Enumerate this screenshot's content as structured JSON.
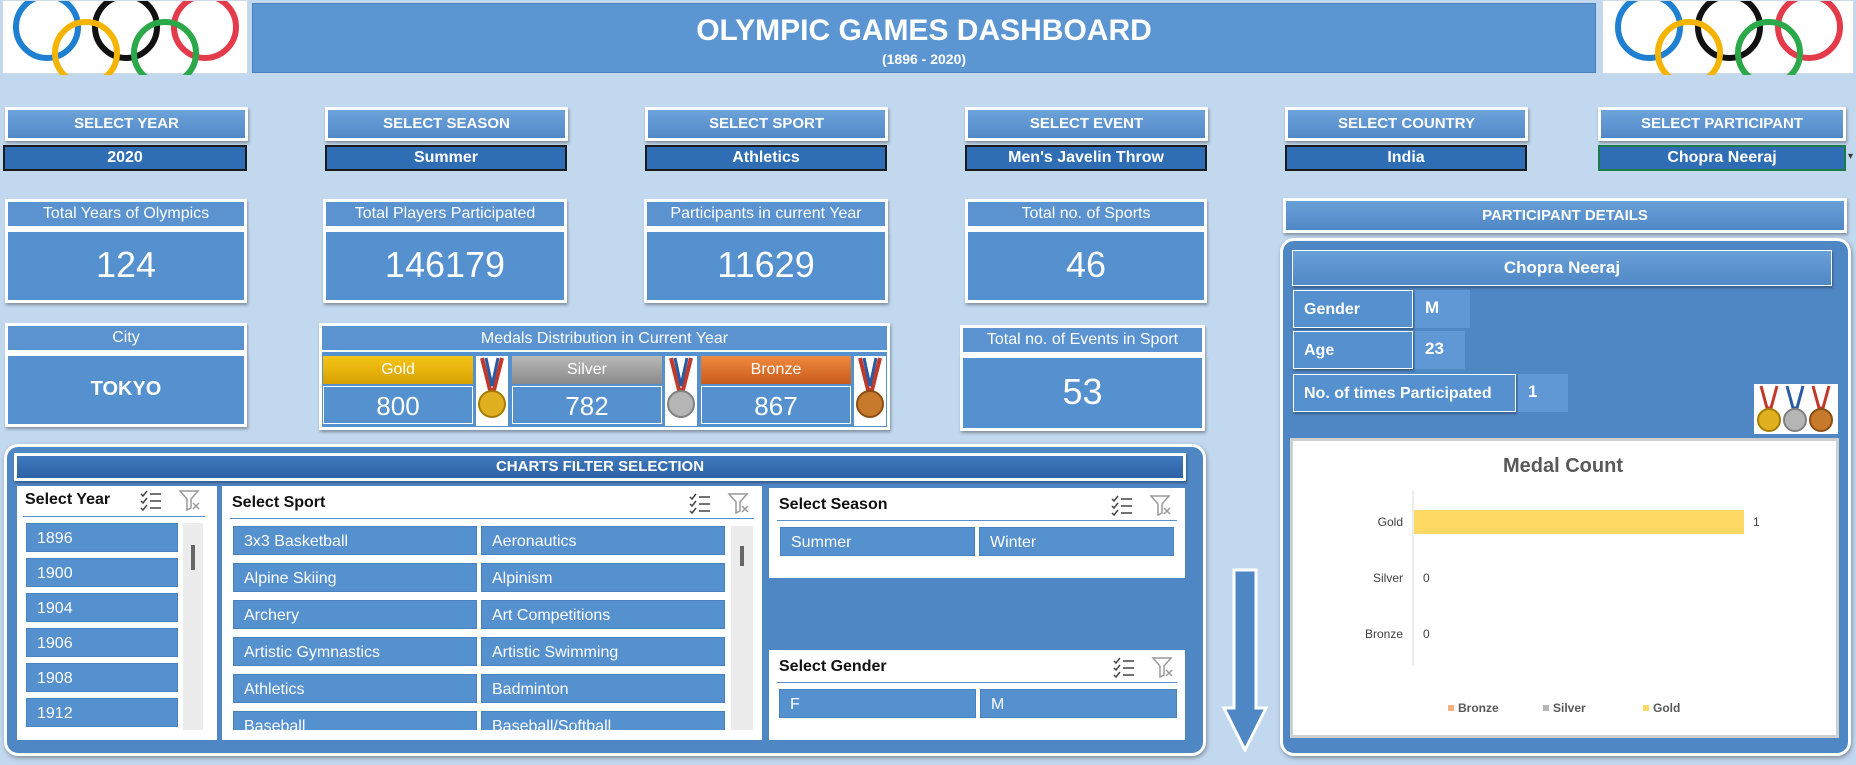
{
  "header": {
    "title": "OLYMPIC GAMES DASHBOARD",
    "subtitle": "(1896 - 2020)"
  },
  "selectors": [
    {
      "label": "SELECT YEAR",
      "value": "2020"
    },
    {
      "label": "SELECT SEASON",
      "value": "Summer"
    },
    {
      "label": "SELECT SPORT",
      "value": "Athletics"
    },
    {
      "label": "SELECT EVENT",
      "value": "Men's Javelin Throw"
    },
    {
      "label": "SELECT COUNTRY",
      "value": "India"
    },
    {
      "label": "SELECT PARTICIPANT",
      "value": "Chopra Neeraj"
    }
  ],
  "kpis": {
    "years": {
      "label": "Total Years of Olympics",
      "value": "124"
    },
    "players": {
      "label": "Total Players Participated",
      "value": "146179"
    },
    "participants": {
      "label": "Participants  in current Year",
      "value": "11629"
    },
    "sports": {
      "label": "Total no. of Sports",
      "value": "46"
    },
    "city": {
      "label": "City",
      "value": "TOKYO"
    },
    "events": {
      "label": "Total no. of Events in Sport",
      "value": "53"
    }
  },
  "medals": {
    "title": "Medals Distribution in Current Year",
    "gold_label": "Gold",
    "gold": "800",
    "silver_label": "Silver",
    "silver": "782",
    "bronze_label": "Bronze",
    "bronze": "867",
    "colors": {
      "gold": "#f2b705",
      "silver": "#9e9e9e",
      "bronze": "#e2742a"
    }
  },
  "charts_filter": {
    "title": "CHARTS FILTER SELECTION",
    "year": {
      "title": "Select Year",
      "items": [
        "1896",
        "1900",
        "1904",
        "1906",
        "1908",
        "1912"
      ]
    },
    "sport": {
      "title": "Select Sport",
      "items": [
        "3x3 Basketball",
        "Aeronautics",
        "Alpine Skiing",
        "Alpinism",
        "Archery",
        "Art Competitions",
        "Artistic Gymnastics",
        "Artistic Swimming",
        "Athletics",
        "Badminton",
        "Baseball",
        "Baseball/Softball"
      ]
    },
    "season": {
      "title": "Select Season",
      "items": [
        "Summer",
        "Winter"
      ]
    },
    "gender": {
      "title": "Select Gender",
      "items": [
        "F",
        "M"
      ]
    }
  },
  "participant": {
    "section_title": "PARTICIPANT DETAILS",
    "name": "Chopra Neeraj",
    "gender_label": "Gender",
    "gender": "M",
    "age_label": "Age",
    "age": "23",
    "times_label": "No. of times Participated",
    "times": "1"
  },
  "chart_data": {
    "type": "bar",
    "title": "Medal Count",
    "categories": [
      "Gold",
      "Silver",
      "Bronze"
    ],
    "values": [
      1,
      0,
      0
    ],
    "legend": [
      "Bronze",
      "Silver",
      "Gold"
    ],
    "legend_position": "bottom",
    "colors": {
      "Gold": "#ffd966",
      "Silver": "#b7b7b7",
      "Bronze": "#f4b183"
    },
    "xlim": [
      0,
      1
    ]
  },
  "icons": [
    "olympic-rings-icon",
    "medal-icon",
    "multi-select-icon",
    "clear-filter-icon",
    "down-arrow-icon",
    "dropdown-icon"
  ]
}
